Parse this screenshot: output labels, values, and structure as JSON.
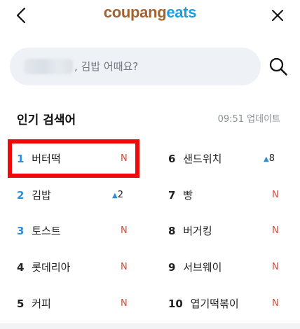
{
  "header": {
    "logo_part1": "coupang",
    "logo_part2": "eats",
    "back_icon": "chevron-left-icon",
    "close_icon": "close-icon"
  },
  "search": {
    "placeholder": ", 김밥 어때요?",
    "icon": "search-icon"
  },
  "popular": {
    "title": "인기 검색어",
    "updated": "09:51 업데이트",
    "items": [
      {
        "rank": "1",
        "label": "버터떡",
        "badge": "N"
      },
      {
        "rank": "2",
        "label": "김밥",
        "badge": "2"
      },
      {
        "rank": "3",
        "label": "토스트",
        "badge": "N"
      },
      {
        "rank": "4",
        "label": "롯데리아",
        "badge": "N"
      },
      {
        "rank": "5",
        "label": "커피",
        "badge": "N"
      },
      {
        "rank": "6",
        "label": "샌드위치",
        "badge": "8"
      },
      {
        "rank": "7",
        "label": "빵",
        "badge": "N"
      },
      {
        "rank": "8",
        "label": "버거킹",
        "badge": "N"
      },
      {
        "rank": "9",
        "label": "서브웨이",
        "badge": "N"
      },
      {
        "rank": "10",
        "label": "엽기떡볶이",
        "badge": "N"
      }
    ]
  },
  "colors": {
    "brand_brown": "#a3632f",
    "brand_blue": "#1a9fe3",
    "new_badge": "#e0452e",
    "up_arrow": "#2f8fd6",
    "highlight": "#ee0a0a"
  }
}
